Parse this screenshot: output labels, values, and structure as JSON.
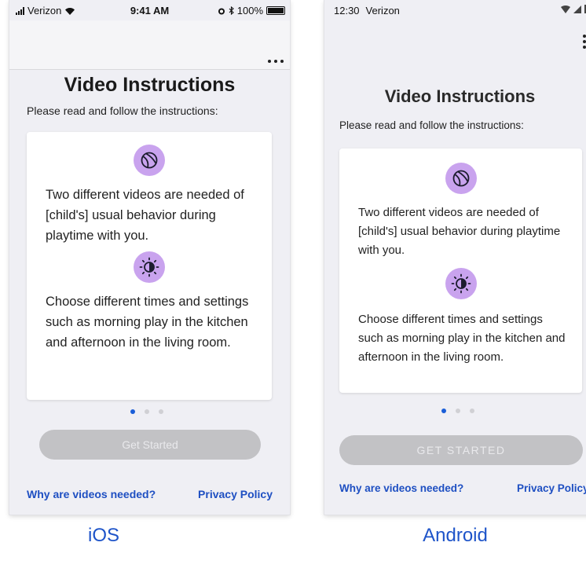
{
  "ios": {
    "status": {
      "carrier": "Verizon",
      "time": "9:41 AM",
      "battery": "100%"
    },
    "title": "Video Instructions",
    "subtitle": "Please read and follow the instructions:",
    "card": {
      "text_1": "Two different videos are needed of [child's] usual behavior during playtime with you.",
      "text_2": "Choose different times and settings such as morning play in the kitchen and afternoon in the living room."
    },
    "pager": {
      "count": 3,
      "active_index": 0
    },
    "button": "Get Started",
    "link_left": "Why are videos needed?",
    "link_right": "Privacy Policy",
    "label": "iOS"
  },
  "android": {
    "status": {
      "time": "12:30",
      "carrier": "Verizon"
    },
    "title": "Video Instructions",
    "subtitle": "Please read and follow the instructions:",
    "card": {
      "text_1": "Two different videos are needed of [child's] usual behavior during playtime with you.",
      "text_2": "Choose different times and settings such as morning play in the kitchen and afternoon in the living room."
    },
    "pager": {
      "count": 3,
      "active_index": 0
    },
    "button": "GET STARTED",
    "link_left": "Why are videos needed?",
    "link_right": "Privacy Policy",
    "label": "Android"
  },
  "colors": {
    "accent": "#1e4fc2",
    "icon_bg": "#c9a3ee",
    "pager_active": "#1a5ed8",
    "button_disabled": "#c2c2c5"
  },
  "icons": [
    "ball-icon",
    "day-night-icon",
    "wifi-icon",
    "signal-icon",
    "battery-icon",
    "alarm-icon",
    "bluetooth-icon",
    "more-options-icon"
  ]
}
